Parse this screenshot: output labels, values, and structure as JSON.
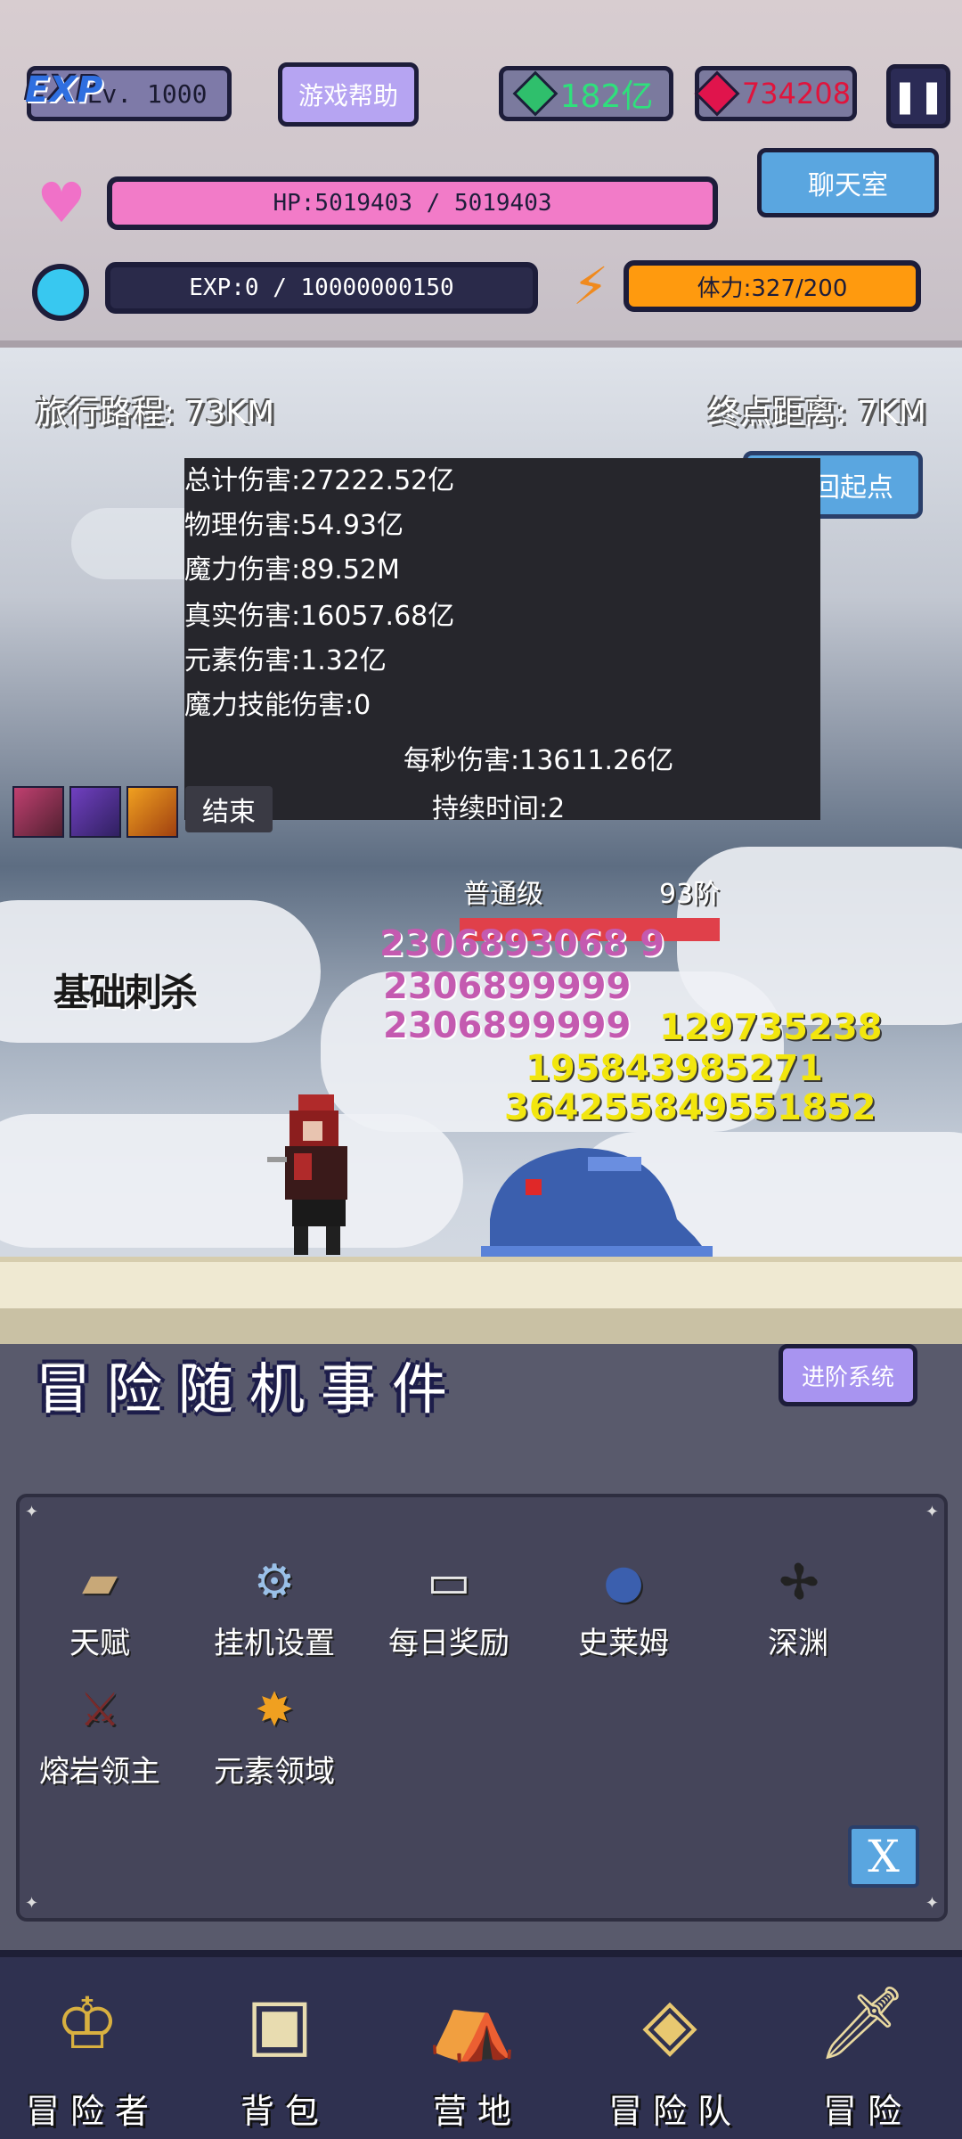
{
  "hud": {
    "exp_badge": "EXP",
    "level": "Lv. 1000",
    "help_button": "游戏帮助",
    "gems": "182亿",
    "rubies": "734208",
    "pause": "❚❚",
    "hp_text": "HP:5019403 / 5019403",
    "hp_fraction": 1.0,
    "exp_text": "EXP:0 / 10000000150",
    "exp_fraction": 0.0,
    "stamina_text": "体力:327/200",
    "stamina_fraction": 1.0,
    "chat_button": "聊天室",
    "colors": {
      "hp": "#f27bc8",
      "exp": "#7a3cf0",
      "stamina": "#ff9a0e",
      "gem": "#2fe07c",
      "ruby": "#e0143c"
    }
  },
  "scene": {
    "route_traveled": "旅行路程: 73KM",
    "route_remaining": "终点距离: 7KM",
    "return_button": "回起点",
    "damage": {
      "total": "总计伤害:27222.52亿",
      "physical": "物理伤害:54.93亿",
      "magic": "魔力伤害:89.52M",
      "true_dmg": "真实伤害:16057.68亿",
      "element": "元素伤害:1.32亿",
      "magic_skill": "魔力技能伤害:0",
      "dps": "每秒伤害:13611.26亿",
      "duration": "持续时间:2"
    },
    "end_button": "结束",
    "enemy_rank": "普通级",
    "enemy_tier": "93阶",
    "skill_text": "基础刺杀",
    "floating_pink": [
      "2306893068 9",
      "2306899999",
      "2306899999"
    ],
    "floating_yellow": [
      "129735238",
      "195843985271",
      "364255849551852"
    ]
  },
  "events": {
    "title": "冒险随机事件",
    "advance_button": "进阶系统",
    "menu": [
      {
        "label": "天赋",
        "icon": "book-icon"
      },
      {
        "label": "挂机设置",
        "icon": "gear-icon"
      },
      {
        "label": "每日奖励",
        "icon": "scroll-icon"
      },
      {
        "label": "史莱姆",
        "icon": "slime-icon"
      },
      {
        "label": "深渊",
        "icon": "abyss-icon"
      },
      {
        "label": "熔岩领主",
        "icon": "lava-sword-icon"
      },
      {
        "label": "元素领域",
        "icon": "element-icon"
      }
    ],
    "close_button": "X"
  },
  "nav": [
    {
      "label": "冒险者",
      "icon": "adventurer-icon"
    },
    {
      "label": "背包",
      "icon": "backpack-icon"
    },
    {
      "label": "营地",
      "icon": "camp-icon"
    },
    {
      "label": "冒险队",
      "icon": "team-icon"
    },
    {
      "label": "冒险",
      "icon": "adventure-icon"
    }
  ]
}
